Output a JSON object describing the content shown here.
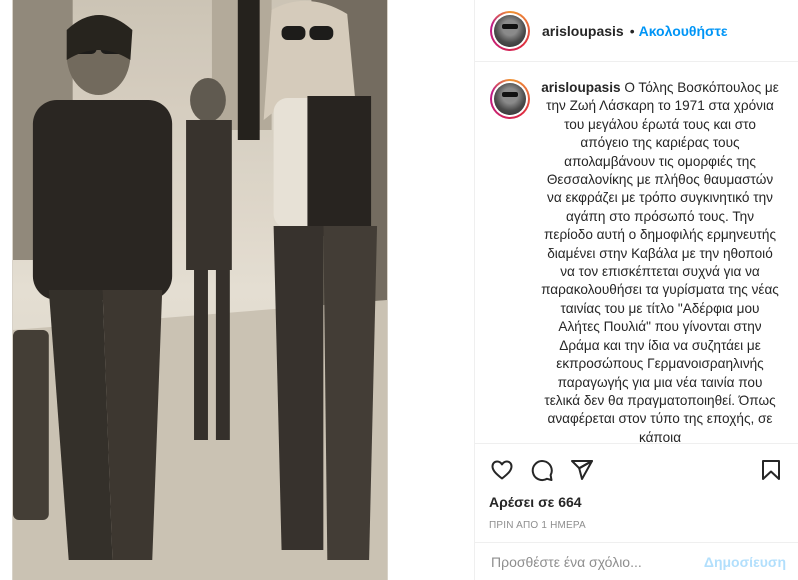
{
  "post": {
    "username": "arisloupasis",
    "separator": "•",
    "follow_label": "Ακολουθήστε",
    "more_label": "",
    "caption": "Ο Τόλης Βοσκόπουλος με την Ζωή Λάσκαρη το 1971 στα χρόνια του μεγάλου έρωτά τους και στο απόγειο της καριέρας τους απολαμβάνουν τις ομορφιές της Θεσσαλονίκης με πλήθος θαυμαστών να εκφράζει με τρόπο συγκινητικό την αγάπη στο πρόσωπό τους. Την περίοδο αυτή ο δημοφιλής ερμηνευτής διαμένει στην Καβάλα με την ηθοποιό να τον επισκέπτεται συχνά για να παρακολουθήσει τα γυρίσματα της νέας ταινίας του με τίτλο \"Αδέρφια μου Αλήτες Πουλιά\" που γίνονται στην Δράμα και την ίδια να συζητάει με εκπροσώπους Γερμανοισραηλινής παραγωγής για μια νέα ταινία που τελικά δεν θα πραγματοποιηθεί. Όπως αναφέρεται στον τύπο της εποχής, σε κάποια",
    "likes_text": "Αρέσει σε 664",
    "time_text": "ΠΡΙΝ ΑΠΟ 1 ΗΜΕΡΑ",
    "comment_placeholder": "Προσθέστε ένα σχόλιο...",
    "post_button": "Δημοσίευση"
  },
  "icons": {
    "like": "heart-icon",
    "comment": "comment-icon",
    "share": "paper-plane-icon",
    "save": "bookmark-icon"
  },
  "colors": {
    "accent": "#0095f6",
    "post_disabled": "#b2dffc",
    "meta": "#8e8e8e",
    "border": "#efefef"
  }
}
